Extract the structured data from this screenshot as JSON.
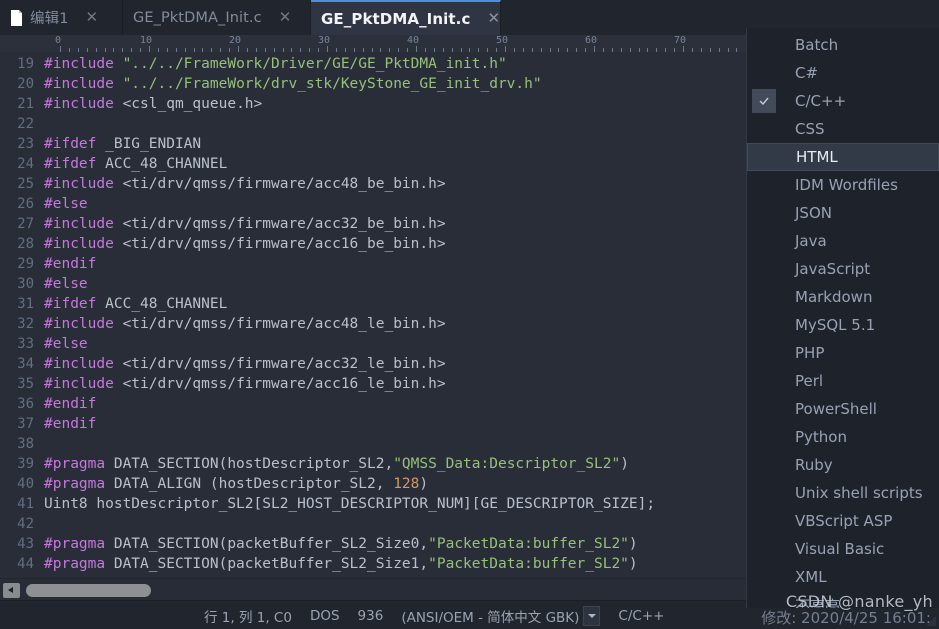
{
  "window": {
    "accent_color": "#4a8fe0",
    "editor_bg": "#282d38",
    "menu_bg": "#1e222a"
  },
  "tabs": [
    {
      "label": "编辑1",
      "close": "✕",
      "active": false,
      "has_icon": true
    },
    {
      "label": "GE_PktDMA_Init.c",
      "close": "✕",
      "active": false,
      "has_icon": false
    },
    {
      "label": "GE_PktDMA_Init.c",
      "close": "✕",
      "active": true,
      "has_icon": false
    }
  ],
  "ruler": {
    "labels": [
      "0",
      "10",
      "20",
      "30",
      "40",
      "50",
      "60",
      "70"
    ]
  },
  "editor": {
    "first_line_number": 19,
    "lines": [
      {
        "n": "19",
        "tokens": [
          {
            "t": "#include ",
            "c": "pre"
          },
          {
            "t": "\"../../FrameWork/Driver/GE/GE_PktDMA_init.h\"",
            "c": "str"
          }
        ]
      },
      {
        "n": "20",
        "tokens": [
          {
            "t": "#include ",
            "c": "pre"
          },
          {
            "t": "\"../../FrameWork/drv_stk/KeyStone_GE_init_drv.h\"",
            "c": "str"
          }
        ]
      },
      {
        "n": "21",
        "tokens": [
          {
            "t": "#include ",
            "c": "pre"
          },
          {
            "t": "<csl_qm_queue.h>",
            "c": "plain"
          }
        ]
      },
      {
        "n": "22",
        "tokens": []
      },
      {
        "n": "23",
        "tokens": [
          {
            "t": "#ifdef ",
            "c": "pre"
          },
          {
            "t": "_BIG_ENDIAN",
            "c": "plain"
          }
        ]
      },
      {
        "n": "24",
        "tokens": [
          {
            "t": "#ifdef ",
            "c": "pre"
          },
          {
            "t": "ACC_48_CHANNEL",
            "c": "plain"
          }
        ]
      },
      {
        "n": "25",
        "tokens": [
          {
            "t": "#include ",
            "c": "pre"
          },
          {
            "t": "<ti/drv/qmss/firmware/acc48_be_bin.h>",
            "c": "plain"
          }
        ]
      },
      {
        "n": "26",
        "tokens": [
          {
            "t": "#else",
            "c": "pre"
          }
        ]
      },
      {
        "n": "27",
        "tokens": [
          {
            "t": "#include ",
            "c": "pre"
          },
          {
            "t": "<ti/drv/qmss/firmware/acc32_be_bin.h>",
            "c": "plain"
          }
        ]
      },
      {
        "n": "28",
        "tokens": [
          {
            "t": "#include ",
            "c": "pre"
          },
          {
            "t": "<ti/drv/qmss/firmware/acc16_be_bin.h>",
            "c": "plain"
          }
        ]
      },
      {
        "n": "29",
        "tokens": [
          {
            "t": "#endif",
            "c": "pre"
          }
        ]
      },
      {
        "n": "30",
        "tokens": [
          {
            "t": "#else",
            "c": "pre"
          }
        ]
      },
      {
        "n": "31",
        "tokens": [
          {
            "t": "#ifdef ",
            "c": "pre"
          },
          {
            "t": "ACC_48_CHANNEL",
            "c": "plain"
          }
        ]
      },
      {
        "n": "32",
        "tokens": [
          {
            "t": "#include ",
            "c": "pre"
          },
          {
            "t": "<ti/drv/qmss/firmware/acc48_le_bin.h>",
            "c": "plain"
          }
        ]
      },
      {
        "n": "33",
        "tokens": [
          {
            "t": "#else",
            "c": "pre"
          }
        ]
      },
      {
        "n": "34",
        "tokens": [
          {
            "t": "#include ",
            "c": "pre"
          },
          {
            "t": "<ti/drv/qmss/firmware/acc32_le_bin.h>",
            "c": "plain"
          }
        ]
      },
      {
        "n": "35",
        "tokens": [
          {
            "t": "#include ",
            "c": "pre"
          },
          {
            "t": "<ti/drv/qmss/firmware/acc16_le_bin.h>",
            "c": "plain"
          }
        ]
      },
      {
        "n": "36",
        "tokens": [
          {
            "t": "#endif",
            "c": "pre"
          }
        ]
      },
      {
        "n": "37",
        "tokens": [
          {
            "t": "#endif",
            "c": "pre"
          }
        ]
      },
      {
        "n": "38",
        "tokens": []
      },
      {
        "n": "39",
        "tokens": [
          {
            "t": "#pragma ",
            "c": "pre"
          },
          {
            "t": "DATA_SECTION(hostDescriptor_SL2,",
            "c": "plain"
          },
          {
            "t": "\"QMSS_Data:Descriptor_SL2\"",
            "c": "str"
          },
          {
            "t": ")",
            "c": "plain"
          }
        ]
      },
      {
        "n": "40",
        "tokens": [
          {
            "t": "#pragma ",
            "c": "pre"
          },
          {
            "t": "DATA_ALIGN (hostDescriptor_SL2, ",
            "c": "plain"
          },
          {
            "t": "128",
            "c": "num"
          },
          {
            "t": ")",
            "c": "plain"
          }
        ]
      },
      {
        "n": "41",
        "tokens": [
          {
            "t": "Uint8 hostDescriptor_SL2[SL2_HOST_DESCRIPTOR_NUM][GE_DESCRIPTOR_SIZE];",
            "c": "plain"
          }
        ]
      },
      {
        "n": "42",
        "tokens": []
      },
      {
        "n": "43",
        "tokens": [
          {
            "t": "#pragma ",
            "c": "pre"
          },
          {
            "t": "DATA_SECTION(packetBuffer_SL2_Size0,",
            "c": "plain"
          },
          {
            "t": "\"PacketData:buffer_SL2\"",
            "c": "str"
          },
          {
            "t": ")",
            "c": "plain"
          }
        ]
      },
      {
        "n": "44",
        "tokens": [
          {
            "t": "#pragma ",
            "c": "pre"
          },
          {
            "t": "DATA_SECTION(packetBuffer_SL2_Size1,",
            "c": "plain"
          },
          {
            "t": "\"PacketData:buffer_SL2\"",
            "c": "str"
          },
          {
            "t": ")",
            "c": "plain"
          }
        ]
      }
    ]
  },
  "statusbar": {
    "position": "行 1, 列 1, C0",
    "line_ending": "DOS",
    "codepage": "936",
    "encoding": "(ANSI/OEM - 简体中文 GBK)",
    "language": "C/C++"
  },
  "menu": {
    "items": [
      {
        "label": "Batch",
        "checked": false,
        "highlight": false
      },
      {
        "label": "C#",
        "checked": false,
        "highlight": false
      },
      {
        "label": "C/C++",
        "checked": true,
        "highlight": false
      },
      {
        "label": "CSS",
        "checked": false,
        "highlight": false
      },
      {
        "label": "HTML",
        "checked": false,
        "highlight": true
      },
      {
        "label": "IDM Wordfiles",
        "checked": false,
        "highlight": false
      },
      {
        "label": "JSON",
        "checked": false,
        "highlight": false
      },
      {
        "label": "Java",
        "checked": false,
        "highlight": false
      },
      {
        "label": "JavaScript",
        "checked": false,
        "highlight": false
      },
      {
        "label": "Markdown",
        "checked": false,
        "highlight": false
      },
      {
        "label": "MySQL 5.1",
        "checked": false,
        "highlight": false
      },
      {
        "label": "PHP",
        "checked": false,
        "highlight": false
      },
      {
        "label": "Perl",
        "checked": false,
        "highlight": false
      },
      {
        "label": "PowerShell",
        "checked": false,
        "highlight": false
      },
      {
        "label": "Python",
        "checked": false,
        "highlight": false
      },
      {
        "label": "Ruby",
        "checked": false,
        "highlight": false
      },
      {
        "label": "Unix shell scripts",
        "checked": false,
        "highlight": false
      },
      {
        "label": "VBScript ASP",
        "checked": false,
        "highlight": false
      },
      {
        "label": "Visual Basic",
        "checked": false,
        "highlight": false
      },
      {
        "label": "XML",
        "checked": false,
        "highlight": false
      },
      {
        "label": "不高亮",
        "checked": false,
        "highlight": false
      }
    ]
  },
  "overlay": {
    "watermark": "CSDN @nanke_yh",
    "modified_text": "修改: 2020/4/25 16:01:"
  }
}
